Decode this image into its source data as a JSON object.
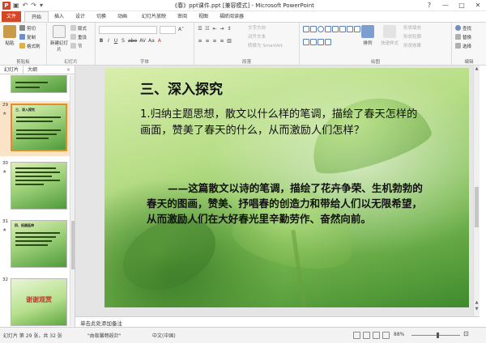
{
  "window": {
    "title": "《春》ppt课件.ppt [兼容模式] - Microsoft PowerPoint",
    "app_icon": "P",
    "qat": [
      "save-icon",
      "undo-icon",
      "redo-icon",
      "customize-icon"
    ],
    "controls": [
      "?",
      "—",
      "□",
      "✕"
    ]
  },
  "tabs": {
    "file": "文件",
    "items": [
      "开始",
      "插入",
      "设计",
      "切换",
      "动画",
      "幻灯片放映",
      "审阅",
      "视图",
      "福昕阅读器"
    ],
    "active_index": 0
  },
  "ribbon": {
    "clipboard": {
      "paste": "粘贴",
      "cut": "剪切",
      "copy": "复制",
      "format_painter": "格式刷",
      "label": "剪贴板"
    },
    "slides": {
      "new_slide": "新建幻灯片",
      "layout": "版式",
      "reset": "重设",
      "section": "节",
      "label": "幻灯片"
    },
    "font": {
      "label": "字体",
      "bold": "B",
      "italic": "I",
      "underline": "U",
      "shadow": "S",
      "strike": "abe",
      "spacing": "AV",
      "case": "Aa",
      "color": "A"
    },
    "paragraph": {
      "text_direction": "文字方向",
      "align_text": "对齐文本",
      "smartart": "转换为 SmartArt",
      "label": "段落"
    },
    "drawing": {
      "arrange": "排列",
      "quick_styles": "快速样式",
      "shape_fill": "形状填充",
      "shape_outline": "形状轮廓",
      "shape_effects": "形状效果",
      "label": "绘图"
    },
    "editing": {
      "find": "查找",
      "replace": "替换",
      "select": "选择",
      "label": "编辑"
    }
  },
  "left_pane": {
    "tabs": [
      "幻灯片",
      "大纲"
    ],
    "close": "×",
    "thumbnails": [
      {
        "num": "",
        "text": "三、…",
        "thanks": ""
      },
      {
        "num": "29",
        "text": "三、深入探究",
        "thanks": ""
      },
      {
        "num": "30",
        "text": "",
        "thanks": ""
      },
      {
        "num": "31",
        "text": "四、拓展延伸",
        "thanks": ""
      },
      {
        "num": "32",
        "text": "",
        "thanks": "谢谢观赏"
      }
    ],
    "selected": 1
  },
  "slide": {
    "title": "三、深入探究",
    "question": "1.归纳主题思想，散文以什么样的笔调，描绘了春天怎样的画面，赞美了春天的什么，从而激励人们怎样？",
    "answer": "——这篇散文以诗的笔调，描绘了花卉争荣、生机勃勃的春天的图画，赞美、抒唱春的创造力和带给人们以无限希望，从而激励人们在大好春光里辛勤劳作、奋然向前。"
  },
  "notes": {
    "placeholder": "单击此处添加备注"
  },
  "status": {
    "slide_info": "幻灯片 第 29 张，共 32 张",
    "theme": "\"由蚁馨畅設計\"",
    "language": "中文(中国)",
    "zoom": "88%",
    "zoom_fraction": 0.55
  }
}
